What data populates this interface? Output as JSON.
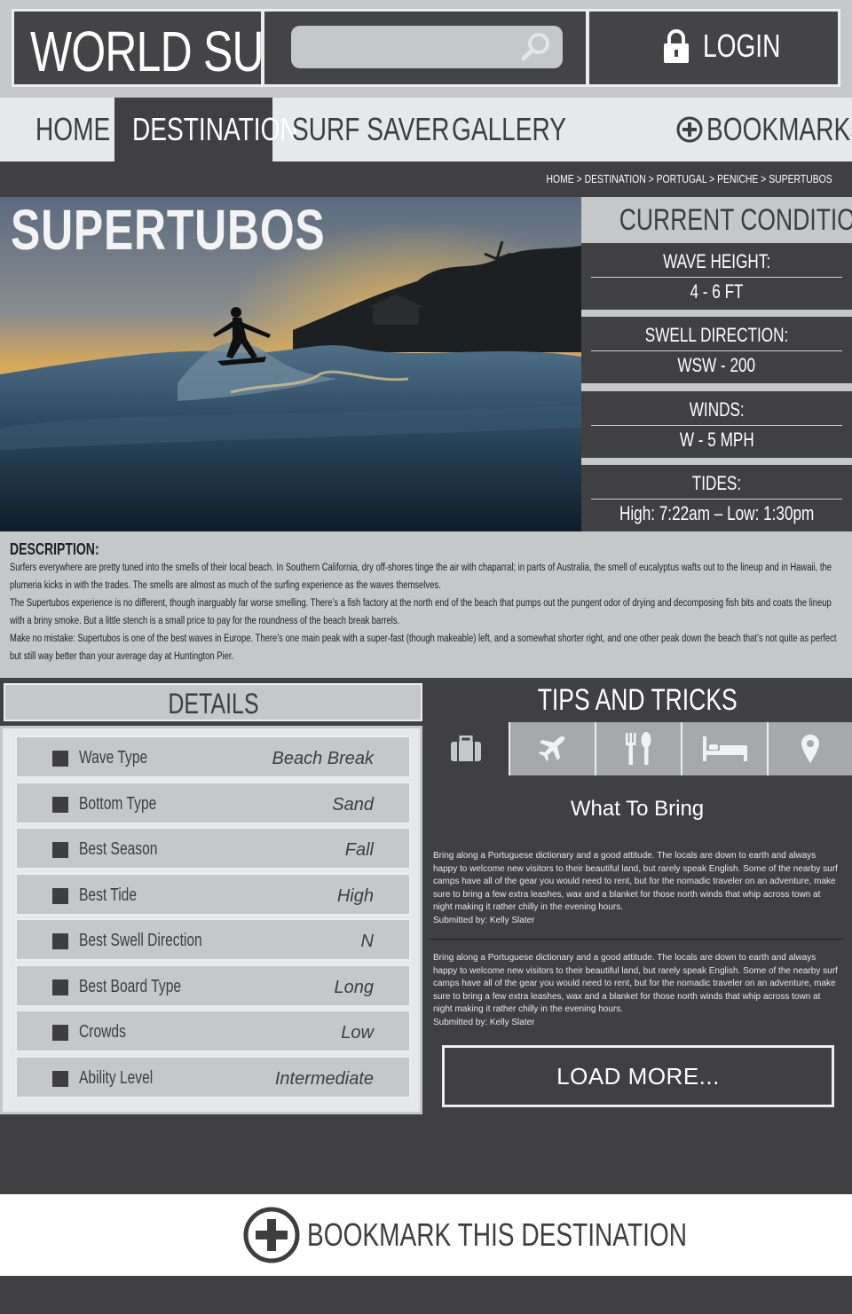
{
  "header": {
    "logo": "WORLD SURF",
    "search_placeholder": "",
    "login_label": "LOGIN"
  },
  "nav": {
    "items": [
      {
        "label": "HOME"
      },
      {
        "label": "DESTINATION"
      },
      {
        "label": "SURF SAVER"
      },
      {
        "label": "GALLERY"
      }
    ],
    "bookmarks_label": "BOOKMARKS"
  },
  "breadcrumb": [
    "HOME",
    "DESTINATION",
    "PORTUGAL",
    "PENICHE",
    "SUPERTUBOS"
  ],
  "hero": {
    "title": "SUPERTUBOS"
  },
  "conditions": {
    "title": "CURRENT CONDITIONS",
    "items": [
      {
        "label": "WAVE HEIGHT:",
        "value": "4 - 6 FT"
      },
      {
        "label": "SWELL DIRECTION:",
        "value": "WSW - 200"
      },
      {
        "label": "WINDS:",
        "value": "W - 5 MPH"
      },
      {
        "label": "TIDES:",
        "value": "High: 7:22am –  Low: 1:30pm"
      }
    ]
  },
  "description": {
    "title": "DESCRIPTION:",
    "paragraphs": [
      "Surfers everywhere are pretty tuned into the smells of their local beach. In Southern California, dry off-shores tinge the air with chaparral; in parts of Australia, the smell of eucalyptus wafts out to the lineup and in Hawaii, the plumeria kicks in with the trades. The smells are almost as much of the surfing experience as the waves themselves.",
      "The Supertubos experience is no different, though inarguably far worse smelling. There’s a fish factory at the north end of the beach that pumps out the pungent odor of drying and decomposing fish bits and coats the lineup with a briny smoke. But a little stench is a small price to pay for the roundness of the beach break barrels.",
      "Make no mistake: Supertubos is one of the best waves in Europe. There’s one main peak with a super-fast (though makeable) left, and a somewhat shorter right, and one other peak down the beach that’s not quite as perfect but still way better than your average day at Huntington Pier."
    ]
  },
  "details": {
    "title": "DETAILS",
    "rows": [
      {
        "label": "Wave Type",
        "value": "Beach Break"
      },
      {
        "label": "Bottom Type",
        "value": "Sand"
      },
      {
        "label": "Best Season",
        "value": "Fall"
      },
      {
        "label": "Best Tide",
        "value": "High"
      },
      {
        "label": "Best Swell Direction",
        "value": "N"
      },
      {
        "label": "Best Board Type",
        "value": "Long"
      },
      {
        "label": "Crowds",
        "value": "Low"
      },
      {
        "label": "Ability Level",
        "value": "Intermediate"
      }
    ]
  },
  "tips": {
    "title": "TIPS AND TRICKS",
    "tabs": [
      "briefcase-icon",
      "airplane-icon",
      "dining-icon",
      "bed-icon",
      "location-pin-icon"
    ],
    "heading": "What To Bring",
    "entries": [
      {
        "text": "Bring along a Portuguese dictionary and a good attitude. The locals are down to earth and always happy to welcome new visitors to their beautiful land, but rarely speak English. Some of the nearby surf camps have all of the gear you would need to rent, but for the nomadic traveler on an adventure, make sure to bring a few extra leashes, wax and a blanket for those north winds that whip across town at night making it rather chilly in the evening hours.",
        "submitted": "Submitted by: Kelly Slater"
      },
      {
        "text": "Bring along a Portuguese dictionary and a good attitude. The locals are down to earth and always happy to welcome new visitors to their beautiful land, but rarely speak English. Some of the nearby  surf camps have all of the gear you would need to rent, but for the nomadic traveler on an adventure, make sure to bring a few extra leashes, wax and a blanket for those north winds that whip across town at night making it rather chilly in the evening hours.",
        "submitted": "Submitted by: Kelly Slater"
      }
    ],
    "load_more": "LOAD MORE..."
  },
  "footer": {
    "bookmark_label": "BOOKMARK THIS DESTINATION"
  },
  "colors": {
    "dark": "#404042",
    "light": "#c6c7c8",
    "pale": "#e7e8e9",
    "white": "#ffffff"
  }
}
